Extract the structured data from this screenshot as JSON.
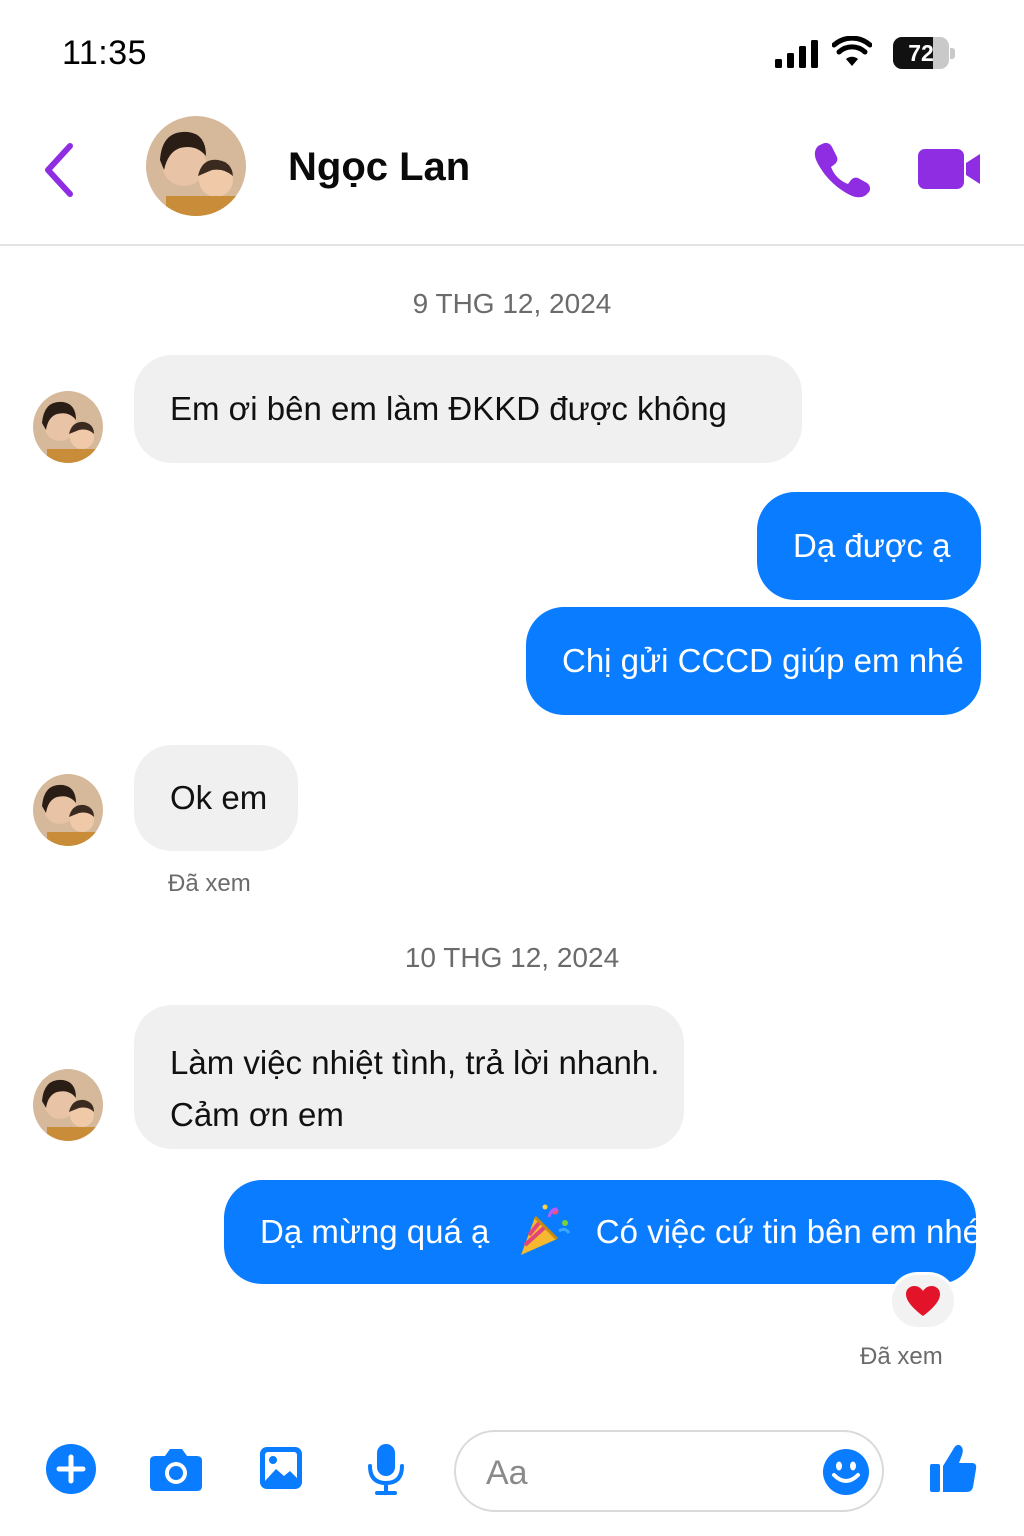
{
  "status_bar": {
    "time": "11:35",
    "battery": "72",
    "battery_level": 0.72
  },
  "header": {
    "contact_name": "Ngọc Lan"
  },
  "messages": {
    "date_1": "9 THG 12, 2024",
    "m1": "Em ơi bên em làm ĐKKD được không",
    "m2": "Dạ được ạ",
    "m3": "Chị gửi CCCD giúp em nhé",
    "m4": "Ok em",
    "seen_1": "Đã xem",
    "date_2": "10 THG 12, 2024",
    "m5_line1": "Làm việc nhiệt tình, trả lời nhanh.",
    "m5_line2": "Cảm ơn em",
    "m6_part1": "Dạ mừng quá ạ",
    "m6_part2": "Có việc cứ tin bên em nhé",
    "m6_reaction": "heart-icon",
    "seen_2": "Đã xem"
  },
  "composer": {
    "placeholder": "Aa"
  },
  "colors": {
    "accent_purple": "#8e2de2",
    "bubble_blue": "#0a7cff",
    "bubble_gray": "#f0f0f0",
    "composer_icon_blue": "#0a7cff"
  }
}
